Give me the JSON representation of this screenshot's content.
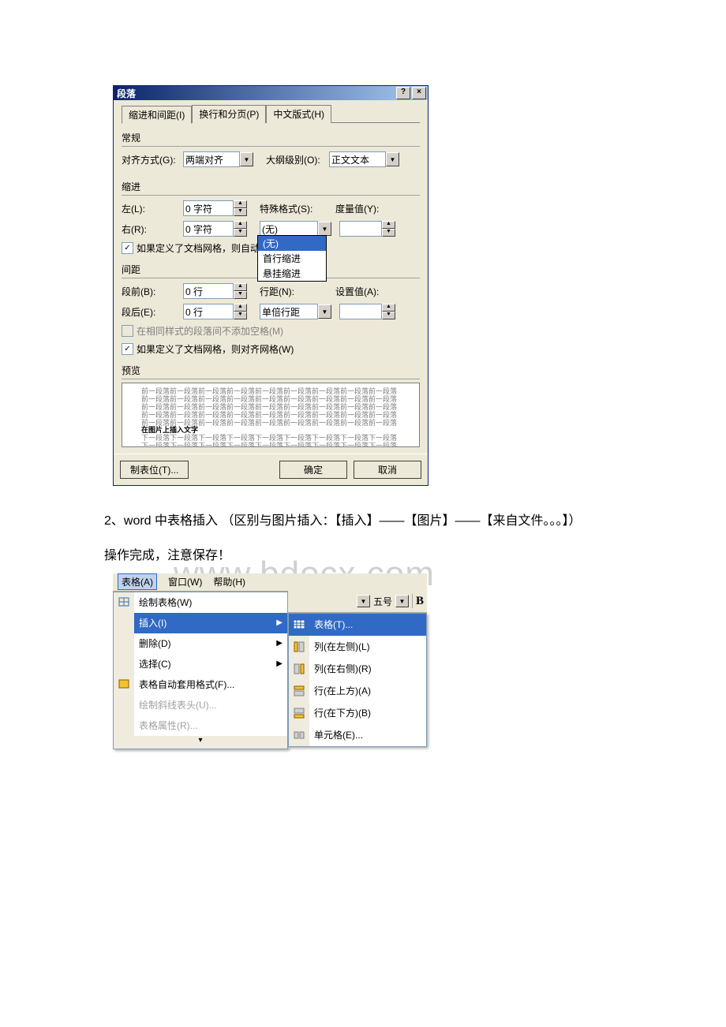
{
  "dialog": {
    "title": "段落",
    "tabs": {
      "t1": "缩进和间距(I)",
      "t2": "换行和分页(P)",
      "t3": "中文版式(H)"
    },
    "section_general": "常规",
    "align_label": "对齐方式(G):",
    "align_value": "两端对齐",
    "outline_label": "大纲级别(O):",
    "outline_value": "正文文本",
    "section_indent": "缩进",
    "left_label": "左(L):",
    "left_value": "0 字符",
    "right_label": "右(R):",
    "right_value": "0 字符",
    "special_label": "特殊格式(S):",
    "special_value": "(无)",
    "special_dropdown": {
      "a": "(无)",
      "b": "首行缩进",
      "c": "悬挂缩进"
    },
    "by_label": "度量值(Y):",
    "chk_grid_indent": "如果定义了文档网格，则自动调",
    "section_spacing": "间距",
    "before_label": "段前(B):",
    "before_value": "0 行",
    "after_label": "段后(E):",
    "after_value": "0 行",
    "linespace_label": "行距(N):",
    "linespace_value": "单倍行距",
    "at_label": "设置值(A):",
    "chk_same_style": "在相同样式的段落间不添加空格(M)",
    "chk_grid_align": "如果定义了文档网格，则对齐网格(W)",
    "section_preview": "预览",
    "preview_prev": "前一段落前一段落前一段落前一段落前一段落前一段落前一段落前一段落前一段落",
    "preview_cur": "在图片上插入文字",
    "preview_next": "下一段落下一段落下一段落下一段落下一段落下一段落下一段落下一段落下一段落",
    "btn_tabs": "制表位(T)...",
    "btn_ok": "确定",
    "btn_cancel": "取消"
  },
  "body": {
    "p1": "2、word 中表格插入 （区别与图片插入：【插入】——【图片】——【来自文件。。。】）",
    "p2": "操作完成，注意保存！",
    "watermark": "www.bdocx.com"
  },
  "menu": {
    "menubar": {
      "table": "表格(A)",
      "window": "窗口(W)",
      "help": "帮助(H)"
    },
    "items": {
      "draw": "绘制表格(W)",
      "insert": "插入(I)",
      "delete": "删除(D)",
      "select": "选择(C)",
      "autoformat": "表格自动套用格式(F)...",
      "drawdiag": "绘制斜线表头(U)...",
      "props": "表格属性(R)..."
    },
    "toolbar": {
      "fontsize": "五号"
    },
    "submenu": {
      "table": "表格(T)...",
      "colL": "列(在左侧)(L)",
      "colR": "列(在右侧)(R)",
      "rowA": "行(在上方)(A)",
      "rowB": "行(在下方)(B)",
      "cell": "单元格(E)..."
    }
  }
}
